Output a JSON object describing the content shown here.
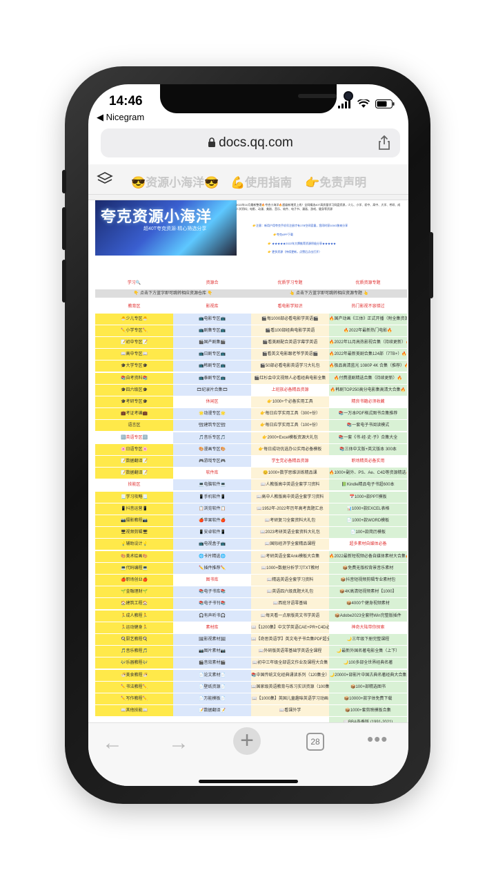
{
  "status": {
    "time": "14:46",
    "back_app": "◀ Nicegram"
  },
  "browser": {
    "url": "docs.qq.com",
    "tab_count": "28"
  },
  "doc_tabs": [
    "😎资源小海洋😎",
    "💪使用指南",
    "👉免责声明"
  ],
  "banner": {
    "title": "夸克资源小海洋",
    "subtitle": "超40T夸克资源·精心筛选分享"
  },
  "notices": [
    "2022年10月最新整理🔥夸克小海洋🔥超级新增资上线！全网精选40T高质量学习网盘资源，少儿、小学、初中、高中、大学、考研、成人学资料；电影、动漫、美剧、音乐、软件、电子书、漫画、游戏、健身等资源",
    "👉注意：新用户用夸克手机号注册才有1TB空间容量，您同时获100G移来分享",
    "👉夸克APP下载",
    "👉 ★★★★★2022年大牌推荐资源积极分享★★★★★",
    "👉 更多资源（持续更新，点赞后点击打开）"
  ],
  "rows": [
    {
      "cells": [
        "学习🔍",
        "资源合",
        "优质学习专题",
        "优质资源专题"
      ],
      "type": "sec"
    },
    {
      "bar": "👇 点击下方蓝字即可跳转相应资源仓库 👇",
      "bar2": "👆 点击下方蓝字即可跳转相应资源专题 👆"
    },
    {
      "cells": [
        "教育区",
        "影视库",
        "看电影学知识",
        "热门影视不容错过"
      ],
      "type": "sec"
    },
    {
      "cells": [
        "🐣少儿专区🐣",
        "📺电影专区📺",
        "🎬每1000部必看电影学英语🎬",
        "🔥国产动画《三体》正式开播（附全集资源）🔥"
      ]
    },
    {
      "cells": [
        "✏️小学专区✏️",
        "📺剧集专区📺",
        "🎬看100部经典电影学英语",
        "🔥2022年最新热门电影🔥"
      ]
    },
    {
      "cells": [
        "📝初中专区📝",
        "🎬国产剧集🎬",
        "🎬看美剧配合英语字幕学英语",
        "🔥2022年11月高热影视合集（持续更新）🔥"
      ]
    },
    {
      "cells": [
        "📖高中专区📖",
        "📺日剧专区📺",
        "🎬看英文电影跟老爷学英语🎬",
        "🔥2022年最新美剧合集124部（7TB+）🔥"
      ]
    },
    {
      "cells": [
        "🎓大学专区🎓",
        "📺韩剧专区📺",
        "🎬50部必看电影英语学习大礼包",
        "🔥极品高清蓝光 1080P 4K 合集（推荐）🔥"
      ]
    },
    {
      "cells": [
        "📚自考资料📚",
        "📺泰剧专区📺",
        "🎬红杉会中文视频人必看经典电影全集",
        "🔥付费漫剧精选合集（持续更新）🔥"
      ]
    },
    {
      "cells": [
        "🎓四六级区🎓",
        "🎞纪录片合集🎞",
        "上班族必备精品资源",
        "🔥韩剧TOP250高分电影集高清大合集🔥"
      ],
      "type": "mix3"
    },
    {
      "cells": [
        "🎓考研专区🎓",
        "休闲区",
        "👉1000+个必备实用工具",
        "精良书籍必须收藏"
      ],
      "type": "mix24"
    },
    {
      "cells": [
        "💼考证考编💼",
        "🌟动漫专区🌟",
        "👉每日应学实用工具（300+份）",
        "📚一万本PDF格式图书合集推荐"
      ]
    },
    {
      "cells": [
        "语言区",
        "🏗建筑专区🏗",
        "👉每日应学实用工具（100+份）",
        "📚一套电子书阅读模式"
      ]
    },
    {
      "cells": [
        "🔠英语专区🔠",
        "🎵音乐专区🎵",
        "👉2000+Excel模板资源大礼包",
        "📚一套《书·经·史·子》合集大全"
      ],
      "type": "mix1"
    },
    {
      "cells": [
        "🌸日语专区🌸",
        "🎨漫画专区🎨",
        "👉每日成功优选办公实用必备模板",
        "📚三体中文版+英文版本 300本"
      ]
    },
    {
      "cells": [
        "📝数据翻译📝",
        "🎮游戏专区🎮",
        "学生党必备精品资源",
        "职场精英必备实用"
      ],
      "type": "mix34"
    },
    {
      "cells": [
        "📝数据翻译📝",
        "软件库",
        "😊1000+数学思维训练精品课",
        "🔥1000+副外、PS、Ae、C4D等资源精选🔥"
      ],
      "type": "mix2"
    },
    {
      "cells": [
        "技能区",
        "💻电脑软件💻",
        "📖人教版高中英语全套学习资料",
        "📗Kindle精品电子书超600本"
      ],
      "type": "mix1"
    },
    {
      "cells": [
        "📃学习攻略📃",
        "📱手机软件📱",
        "📖高中人教版高中英语全套学习资料",
        "📅1000+款PPT模板"
      ]
    },
    {
      "cells": [
        "📱抖音运营📱",
        "📋浏览软件📋",
        "📖1952年-2022年历年高考真题汇总",
        "📊1000+款EXCEL表格"
      ]
    },
    {
      "cells": [
        "📷摄影教程📷",
        "🍎苹果软件🍎",
        "📖考研复习全套资料大礼包",
        "📄1000+款WORD模板"
      ]
    },
    {
      "cells": [
        "🖥视频剪辑🖥",
        "📱安卓软件📱",
        "📖2023考研英语全套资料大礼包",
        "📄100+款简历模板"
      ]
    },
    {
      "cells": [
        "💡辅助设计💡",
        "📺电视盒子📺",
        "📖国际经济学全套精品课程",
        "超多素材自媒体必备"
      ],
      "type": "mix4"
    },
    {
      "cells": [
        "🎨美术绘画🎨",
        "🌐卡片精选🌐",
        "📖考研英语全套Anki模板大合集",
        "🔥2022最新短视频必备自媒体素材大合集🔥"
      ]
    },
    {
      "cells": [
        "💻代码编程💻",
        "✏️插件推荐✏️",
        "📖1000+数据分析学习TXT教材",
        "📦免费无版权背景音乐素材"
      ]
    },
    {
      "cells": [
        "🍎职场创业🍎",
        "图书库",
        "📖精选英语全套学习资料",
        "📦抖音短视频剪辑专业素材包"
      ],
      "type": "mix2"
    },
    {
      "cells": [
        "🌱金融理财🌱",
        "📚电子书库📚",
        "📖英语四六级真题大礼包",
        "📦4K高清短视频素材【1000】"
      ]
    },
    {
      "cells": [
        "🏠建筑工程🏠",
        "📚电子书刊📚",
        "📖西班牙语零基础",
        "📦4000个健身视频素材"
      ]
    },
    {
      "cells": [
        "🏃成人教程🏃",
        "🎧有声听书🎧",
        "📖每天看一点原版英文书学英语",
        "📦Adobe2023全套特Win完整版插件"
      ]
    },
    {
      "cells": [
        "🏃运动健身🏃",
        "素材库",
        "📖【1200集】中文学英语CAE+PR+C4D必学",
        "神奇大陆带你探索"
      ],
      "type": "mix24"
    },
    {
      "cells": [
        "🍳厨艺教程🍳",
        "🖼影视素材🖼",
        "📖【奇思英语学】英文电子书合集PDF超全",
        "🌙三年级下册完整课程"
      ]
    },
    {
      "cells": [
        "🎵音乐教程🎵",
        "📷图片素材📷",
        "📖外研版英语零基础学英语全课程",
        "🌙最新外国名著电影全集（上下）"
      ]
    },
    {
      "cells": [
        "🎶乐器教程🎶",
        "🎬音效素材🎬",
        "📖初中三年级全部语文作业及课程大合集",
        "🌙100多部全世界经典名著"
      ]
    },
    {
      "cells": [
        "🍜美食教程🍜",
        "📄论文素材📄",
        "📚中国传统文化经典诵读系列（120集全）",
        "🌙20000+部影片中国古典名著经典大合集"
      ]
    },
    {
      "cells": [
        "✏️书法教程✏️",
        "📄壁纸资源📄",
        "📖国家级英语教育与练习实训资源（100集全）",
        "📦100+部精选图书"
      ]
    },
    {
      "cells": [
        "✏️写作教程✏️",
        "📄万能模板📄",
        "📖【1000集】英国儿童趣味英语学习动画",
        "📦10000+款字体免费下载"
      ]
    },
    {
      "cells": [
        "📖其他技能📖",
        "📝数据翻译📝",
        "📖看课外学",
        "📦1000+套剪映模板合集"
      ]
    },
    {
      "cells": [
        "",
        "",
        "",
        "📖BBA各季版 (1991-2021)"
      ],
      "type": "last"
    }
  ]
}
